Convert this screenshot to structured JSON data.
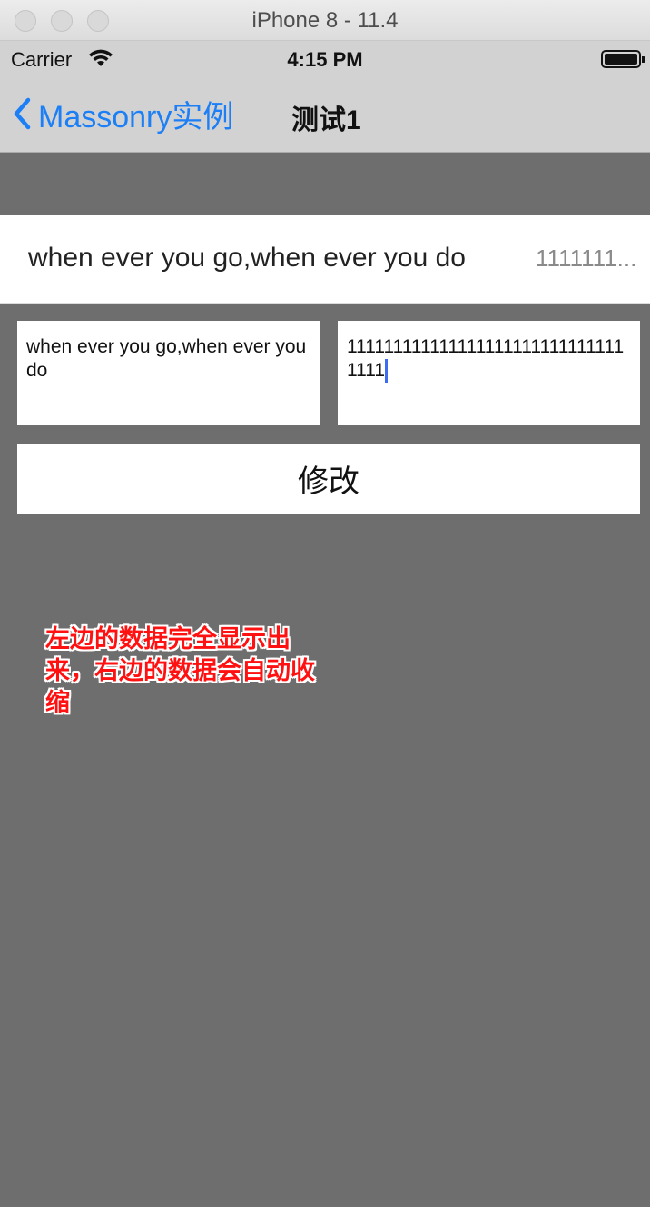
{
  "window": {
    "title": "iPhone 8 - 11.4"
  },
  "status_bar": {
    "carrier": "Carrier",
    "time": "4:15 PM"
  },
  "nav_bar": {
    "back_label": "Massonry实例",
    "title": "测试1"
  },
  "display_row": {
    "left_label": "when ever you go,when ever you do",
    "right_label": "1111111..."
  },
  "inputs": {
    "left_value": "when ever you go,when ever you do",
    "right_value": "1111111111111111111111111111111111"
  },
  "modify_button": {
    "label": "修改"
  },
  "annotation": {
    "text": "左边的数据完全显示出来，右边的数据会自动收缩"
  },
  "colors": {
    "accent": "#1c7ff5",
    "background": "#6e6e6e",
    "annotation": "#ff1111"
  }
}
